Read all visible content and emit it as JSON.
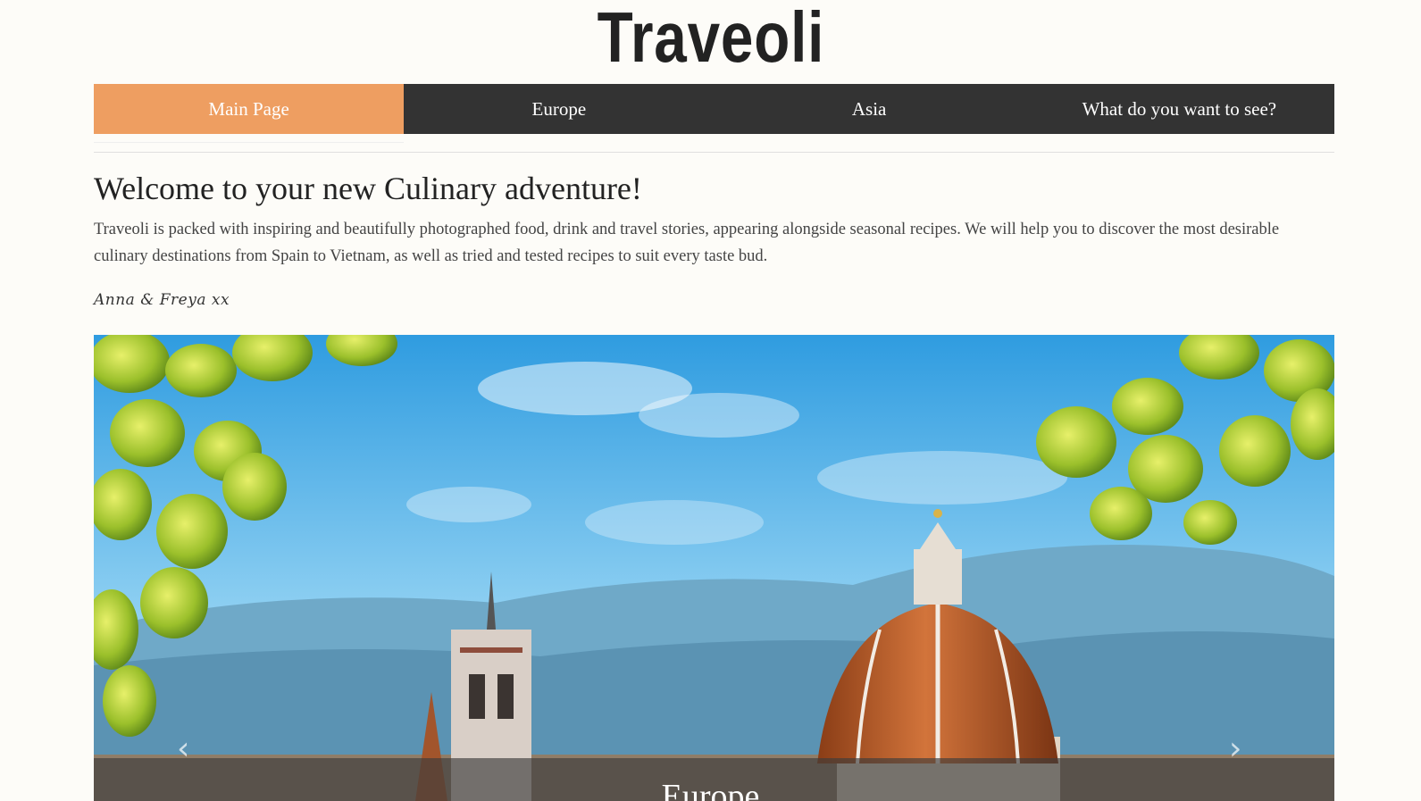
{
  "header": {
    "logo": "Traveoli"
  },
  "nav": {
    "items": [
      {
        "label": "Main Page",
        "active": true
      },
      {
        "label": "Europe",
        "active": false
      },
      {
        "label": "Asia",
        "active": false
      },
      {
        "label": "What do you want to see?",
        "active": false
      }
    ]
  },
  "main": {
    "title": "Welcome to your new Culinary adventure!",
    "intro": "Traveoli is packed with inspiring and beautifully photographed food, drink and travel stories, appearing alongside seasonal recipes. We will help you to discover the most desirable culinary destinations from Spain to Vietnam, as well as tried and tested recipes to suit every taste bud.",
    "signature": "Anna & Freya xx"
  },
  "carousel": {
    "caption": "Europe",
    "prev_icon": "chevron-left-icon",
    "next_icon": "chevron-right-icon"
  },
  "colors": {
    "accent": "#ee9e61",
    "nav_bg": "#333333",
    "page_bg": "#fdfcf8"
  }
}
